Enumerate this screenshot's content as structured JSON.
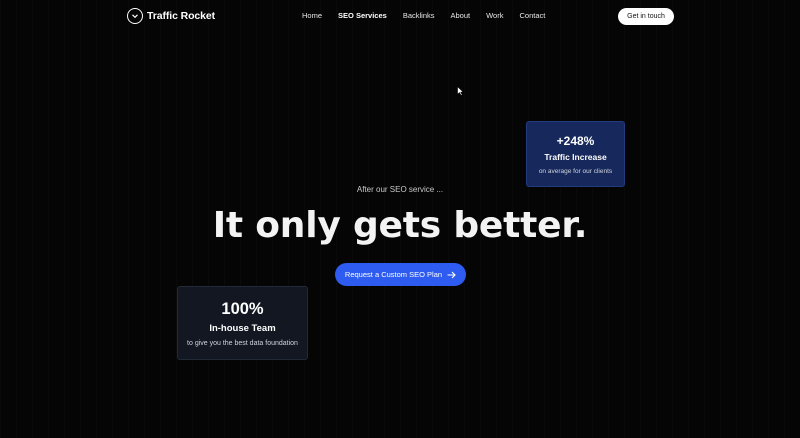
{
  "brand": {
    "name": "Traffic Rocket",
    "icon": "chevron-down-circle-icon"
  },
  "nav": {
    "items": [
      {
        "label": "Home",
        "active": false
      },
      {
        "label": "SEO Services",
        "active": true
      },
      {
        "label": "Backlinks",
        "active": false
      },
      {
        "label": "About",
        "active": false
      },
      {
        "label": "Work",
        "active": false
      },
      {
        "label": "Contact",
        "active": false
      }
    ],
    "cta_label": "Get in touch"
  },
  "hero": {
    "pre": "After our SEO service ...",
    "title": "It only gets better.",
    "button_label": "Request a Custom SEO Plan",
    "button_icon": "arrow-right-icon"
  },
  "stats": {
    "traffic": {
      "value": "+248%",
      "label": "Traffic Increase",
      "sub": "on average for our clients"
    },
    "team": {
      "value": "100%",
      "label": "In-house Team",
      "sub": "to give you the best data foundation"
    }
  },
  "colors": {
    "background": "#050505",
    "accent": "#2f5cf0",
    "card_blue": "#17285c",
    "card_dark": "#121722"
  }
}
